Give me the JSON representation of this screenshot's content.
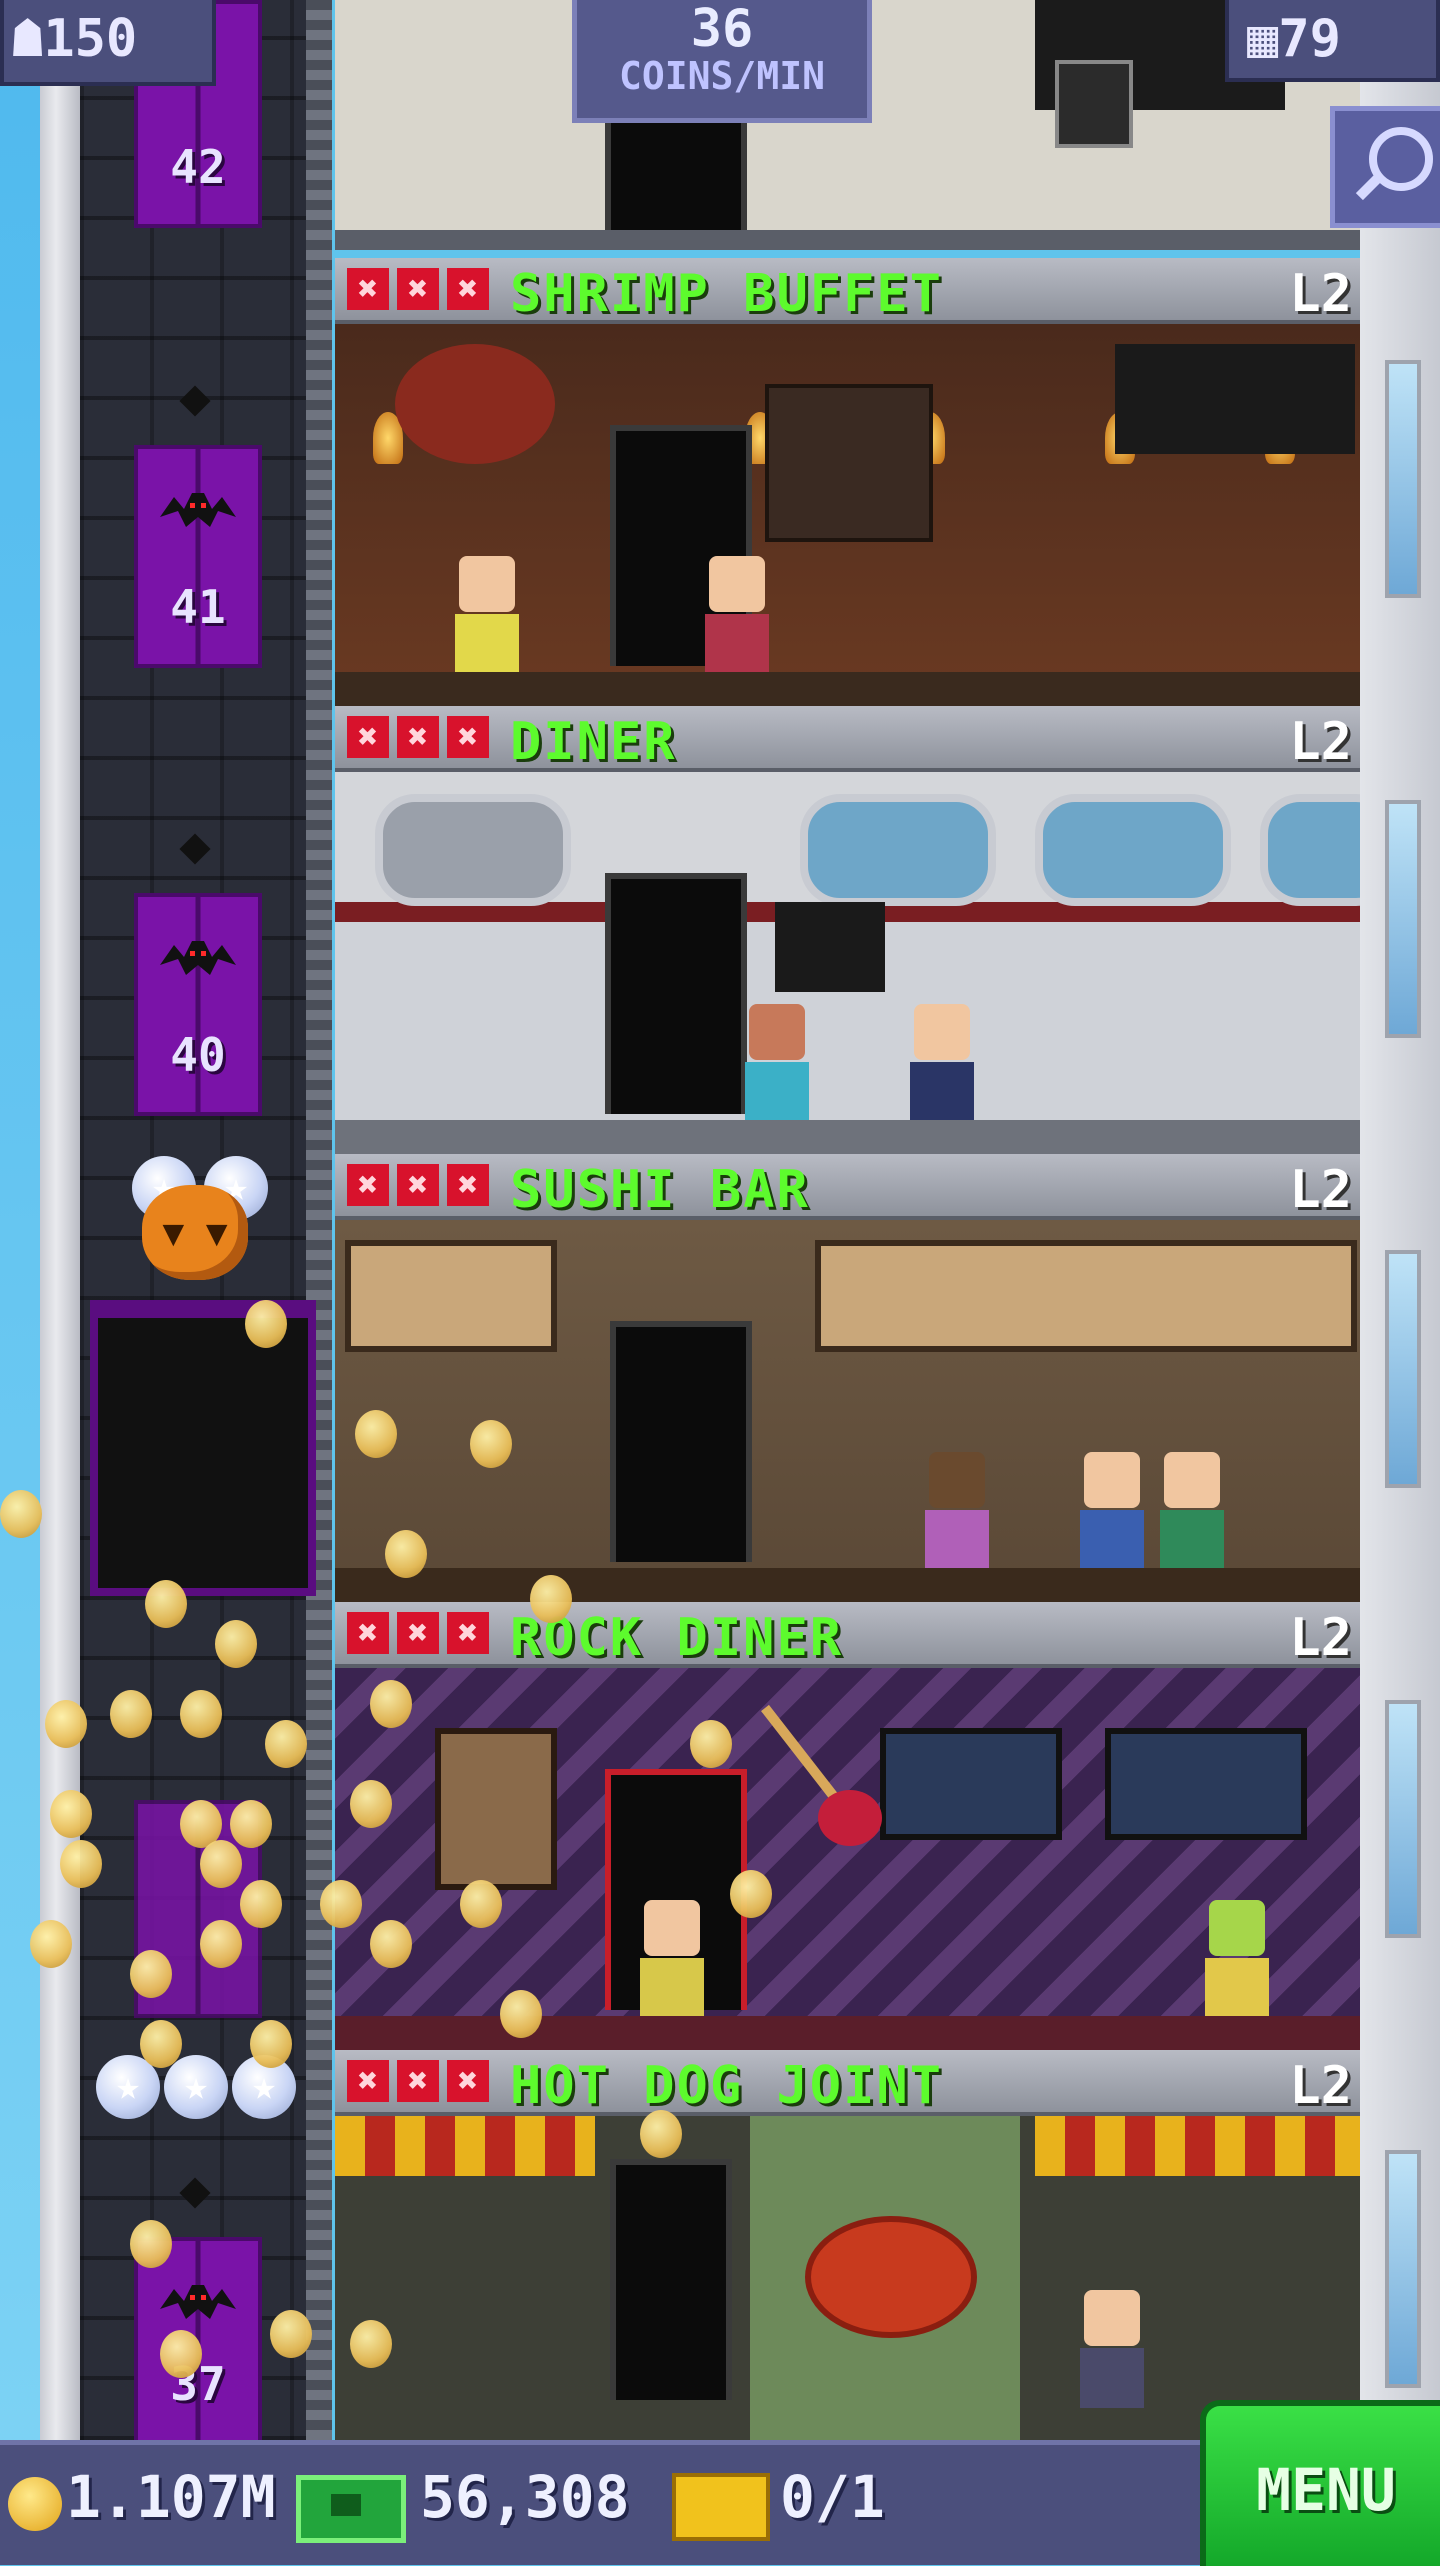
{
  "hud": {
    "population": "150",
    "coins_per_min_value": "36",
    "coins_per_min_unit": "COINS/MIN",
    "floor_count": "79",
    "search_icon": "magnifier-icon"
  },
  "elevator": {
    "floor_labels": [
      "42",
      "41",
      "40",
      "37"
    ]
  },
  "floors": [
    {
      "name": "SHRIMP BUFFET",
      "level": "L2",
      "marks": [
        "✖",
        "✖",
        "✖"
      ]
    },
    {
      "name": "DINER",
      "level": "L2",
      "marks": [
        "✖",
        "✖",
        "✖"
      ]
    },
    {
      "name": "SUSHI BAR",
      "level": "L2",
      "marks": [
        "✖",
        "✖",
        "✖"
      ]
    },
    {
      "name": "ROCK DINER",
      "level": "L2",
      "marks": [
        "✖",
        "✖",
        "✖"
      ]
    },
    {
      "name": "HOT DOG JOINT",
      "level": "L2",
      "marks": [
        "✖",
        "✖",
        "✖"
      ]
    }
  ],
  "bottom_bar": {
    "coins": "1.107M",
    "bux": "56,308",
    "tickets": "0/1",
    "menu_label": "MENU"
  },
  "colors": {
    "floor_name": "#5dfb2d",
    "menu_green": "#22c737",
    "elevator_purple": "#7a13a8",
    "hud_bg": "#4b4f7c"
  }
}
